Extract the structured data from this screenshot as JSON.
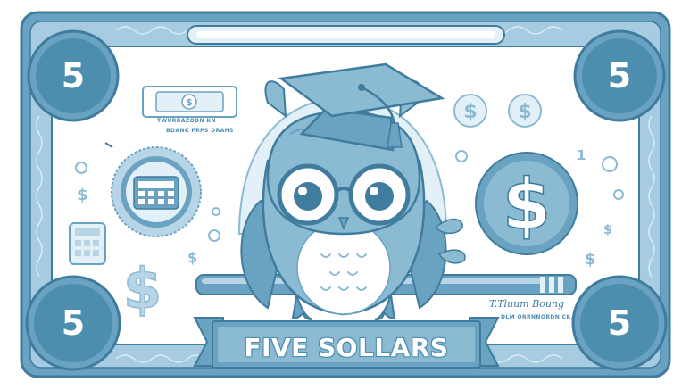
{
  "banknote": {
    "denomination_label": "FIVE SOLLARS",
    "corner_values": [
      "5",
      "5",
      "5",
      "5"
    ],
    "small_bill_text_1": "TWURRAZODN KN",
    "small_bill_text_2": "BDANK PRPS DRAHS",
    "signature": "T.Tluum Boung",
    "signature_caption": "DLM ORRNNORDN CK.",
    "numeral_mark": "1"
  },
  "colors": {
    "dark_blue": "#3f7c9d",
    "mid_blue": "#6aa3c2",
    "light_blue": "#b7d5e6",
    "pale_blue": "#e4f0f7",
    "white": "#ffffff"
  },
  "icons": [
    "owl-icon",
    "graduation-cap-icon",
    "glasses-icon",
    "dollar-sign-icon",
    "calculator-icon",
    "seal-icon",
    "pencil-icon",
    "leaf-icon"
  ]
}
